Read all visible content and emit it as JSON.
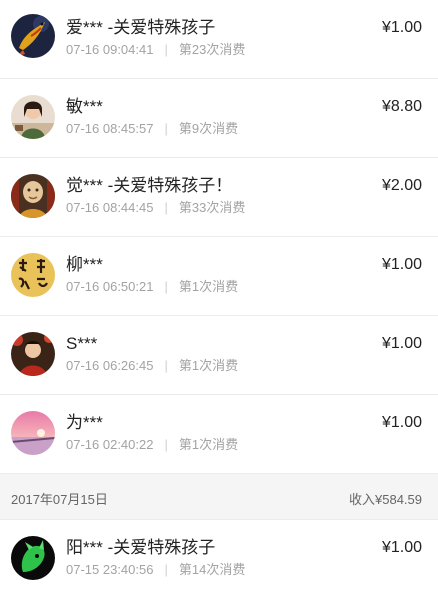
{
  "records": [
    {
      "name": "爱*** -关爱特殊孩子",
      "time": "07-16 09:04:41",
      "count": "第23次消费",
      "amount": "¥1.00",
      "avatar_icon": "koi-fish-avatar-icon"
    },
    {
      "name": "敏***",
      "time": "07-16 08:45:57",
      "count": "第9次消费",
      "amount": "¥8.80",
      "avatar_icon": "woman-portrait-avatar-icon"
    },
    {
      "name": "觉*** -关爱特殊孩子！",
      "time": "07-16 08:44:45",
      "count": "第33次消费",
      "amount": "¥2.00",
      "avatar_icon": "monk-statue-avatar-icon"
    },
    {
      "name": "柳***",
      "time": "07-16 06:50:21",
      "count": "第1次消费",
      "amount": "¥1.00",
      "avatar_icon": "calligraphy-avatar-icon"
    },
    {
      "name": "S***",
      "time": "07-16 06:26:45",
      "count": "第1次消费",
      "amount": "¥1.00",
      "avatar_icon": "woman-red-avatar-icon"
    },
    {
      "name": "为***",
      "time": "07-16 02:40:22",
      "count": "第1次消费",
      "amount": "¥1.00",
      "avatar_icon": "sunset-sea-avatar-icon"
    }
  ],
  "day_header": {
    "date": "2017年07月15日",
    "income": "收入¥584.59"
  },
  "records2": [
    {
      "name": "阳*** -关爱特殊孩子",
      "time": "07-15 23:40:56",
      "count": "第14次消费",
      "amount": "¥1.00",
      "avatar_icon": "green-dragon-avatar-icon"
    }
  ]
}
